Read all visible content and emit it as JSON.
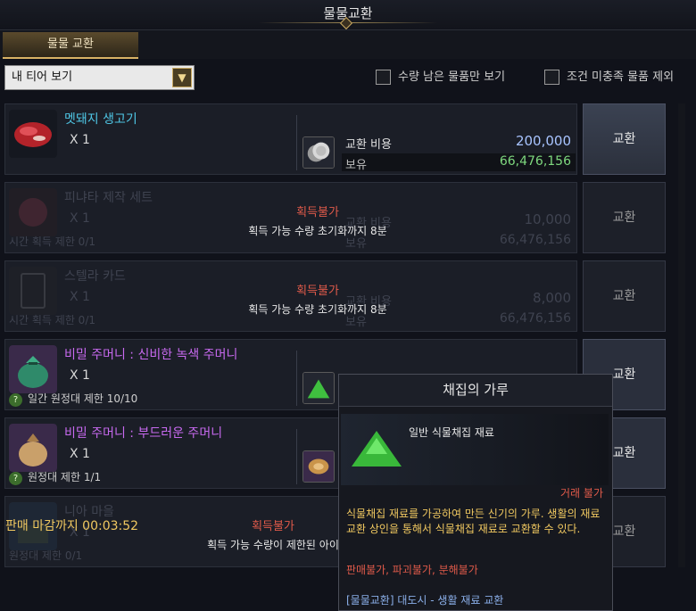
{
  "window": {
    "title": "물물교환"
  },
  "tabs": [
    {
      "label": "물물 교환",
      "active": true
    }
  ],
  "filters": {
    "tier_dropdown": "내 티어 보기",
    "remaining_only": "수량 남은 물품만 보기",
    "hide_unmet": "조건 미충족 물품 제외"
  },
  "items": [
    {
      "name": "멧돼지 생고기",
      "qty": "X 1",
      "limit": "",
      "cost_label": "교환 비용",
      "cost": "200,000",
      "owned_label": "보유",
      "owned": "66,476,156",
      "blocked": "",
      "blocked_note": "",
      "button": "교환"
    },
    {
      "name": "피냐타 제작 세트",
      "qty": "X 1",
      "limit": "시간 획득 제한 0/1",
      "cost_label": "교환 비용",
      "cost": "10,000",
      "owned_label": "보유",
      "owned": "66,476,156",
      "blocked": "획득불가",
      "blocked_note": "획득 가능 수량 초기화까지 8분",
      "button": "교환"
    },
    {
      "name": "스텔라 카드",
      "qty": "X 1",
      "limit": "시간 획득 제한 0/1",
      "cost_label": "교환 비용",
      "cost": "8,000",
      "owned_label": "보유",
      "owned": "66,476,156",
      "blocked": "획득불가",
      "blocked_note": "획득 가능 수량 초기화까지 8분",
      "button": "교환"
    },
    {
      "name": "비밀 주머니 : 신비한 녹색 주머니",
      "qty": "X 1",
      "limit": "일간 원정대 제한 10/10",
      "cost_label": "교환 비용",
      "cost": "",
      "owned_label": "",
      "owned": "",
      "blocked": "",
      "blocked_note": "",
      "button": "교환"
    },
    {
      "name": "비밀 주머니 : 부드러운 주머니",
      "qty": "X 1",
      "limit": "원정대 제한 1/1",
      "cost_label": "",
      "cost": "",
      "owned_label": "",
      "owned": "",
      "blocked": "",
      "blocked_note": "",
      "button": "교환"
    },
    {
      "name": "니아 마을",
      "qty": "X 1",
      "limit": "원정대 제한 0/1",
      "cost_label": "",
      "cost": "",
      "owned_label": "",
      "owned": "",
      "blocked": "획득불가",
      "blocked_note": "획득 가능 수량이 제한된 아이",
      "button": "교환"
    }
  ],
  "footer": {
    "deadline": "판매 마감까지 00:03:52"
  },
  "tooltip": {
    "title": "채집의 가루",
    "category": "일반 식물채집 재료",
    "trade": "거래 불가",
    "description": "식물채집 재료를 가공하여 만든 신기의 가루. 생활의 재료 교환 상인을 통해서 식물채집 재료로 교환할 수 있다.",
    "flags": "판매불가, 파괴불가, 분해불가",
    "source": "[물물교환] 대도시 - 생활 재료 교환"
  },
  "colors": {
    "accent_gold": "#c9a961",
    "owned_green": "#7ed87e",
    "cost_blue": "#a8c4ff",
    "warning_red": "#e05a4a",
    "name_cyan": "#4fc7e6",
    "name_purple": "#c86af0"
  },
  "icons": {
    "meat": "raw-meat-icon",
    "silver": "silver-coin-icon",
    "green_pouch": "green-pouch-icon",
    "soft_pouch": "cloth-pouch-icon",
    "powder": "green-powder-icon",
    "card": "card-icon",
    "pinata": "pinata-icon",
    "village": "village-icon"
  }
}
